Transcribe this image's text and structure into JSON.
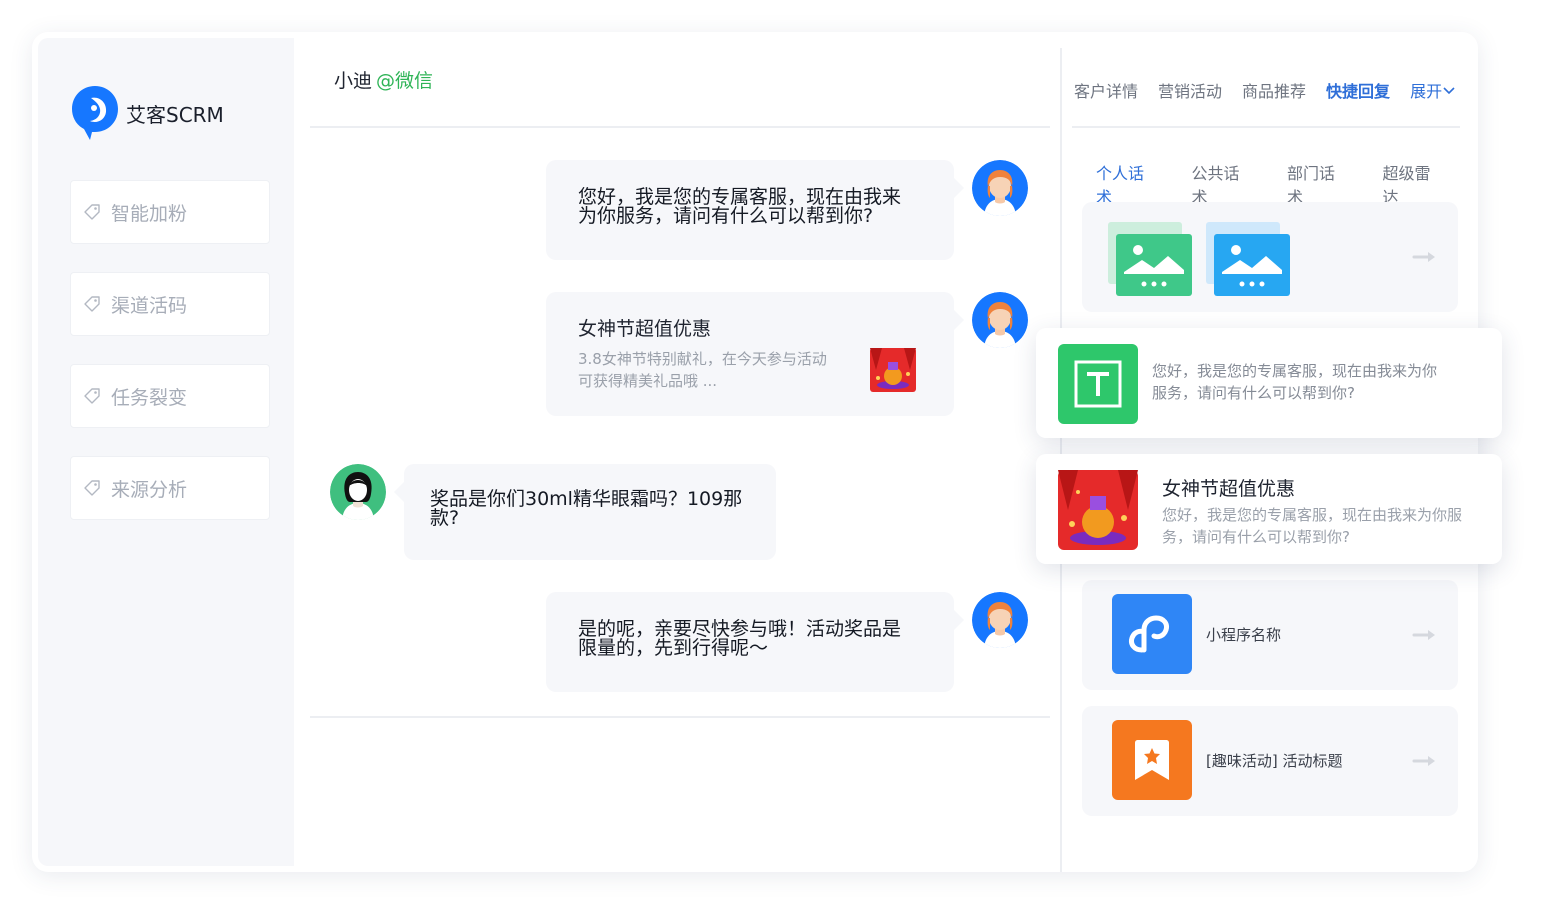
{
  "brand": {
    "name": "艾客SCRM",
    "accent": "#1677ff"
  },
  "sidebar": {
    "items": [
      {
        "label": "智能加粉"
      },
      {
        "label": "渠道活码"
      },
      {
        "label": "任务裂变"
      },
      {
        "label": "来源分析"
      }
    ]
  },
  "chat": {
    "contact_name": "小迪",
    "contact_source": "@微信",
    "messages": [
      {
        "from": "agent",
        "type": "text",
        "text_lines": [
          "您好，我是您的专属客服，现在由我来",
          "为你服务，请问有什么可以帮到你?"
        ]
      },
      {
        "from": "agent",
        "type": "card",
        "title": "女神节超值优惠",
        "desc_lines": [
          "3.8女神节特别献礼，在今天参与活动",
          "可获得精美礼品哦 ..."
        ]
      },
      {
        "from": "customer",
        "type": "text",
        "text_lines": [
          "奖品是你们30ml精华眼霜吗？109那",
          "款?"
        ]
      },
      {
        "from": "agent",
        "type": "text",
        "text_lines": [
          "是的呢，亲要尽快参与哦！活动奖品是",
          "限量的，先到行得呢～"
        ]
      }
    ]
  },
  "right_panel": {
    "tabs": [
      "客户详情",
      "营销活动",
      "商品推荐",
      "快捷回复"
    ],
    "active_tab": "快捷回复",
    "expand_label": "展开",
    "subtabs": [
      "个人话术",
      "公共话术",
      "部门话术",
      "超级雷达"
    ],
    "active_subtab": "个人话术",
    "float_cards": [
      {
        "kind": "text",
        "desc_lines": [
          "您好，我是您的专属客服，现在由我来为你",
          "服务，请问有什么可以帮到你?"
        ]
      },
      {
        "kind": "image",
        "title": "女神节超值优惠",
        "desc_lines": [
          "您好，我是您的专属客服，现在由我来为你服",
          "务，请问有什么可以帮到你?"
        ]
      }
    ],
    "mini_program_label": "小程序名称",
    "activity_label": "[趣味活动] 活动标题"
  }
}
